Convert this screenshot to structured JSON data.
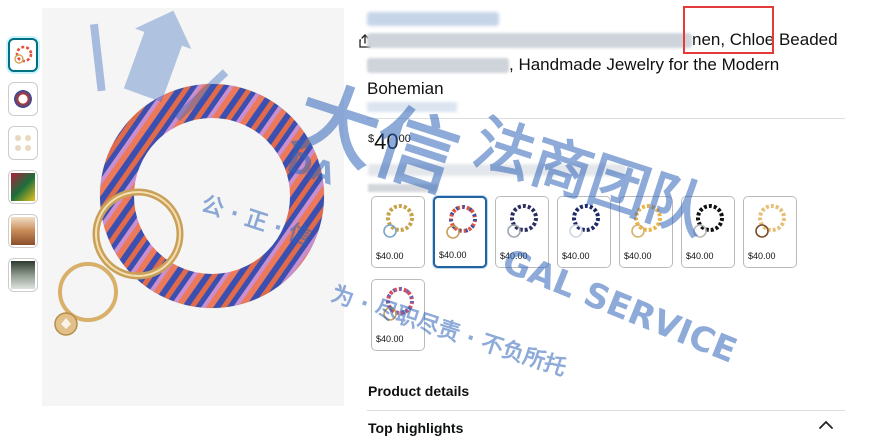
{
  "product": {
    "title_line1_visible": "nen, Chloe Beaded",
    "title_line2_visible": ", Handmade Jewelry for the Modern",
    "title_line3": "Bohemian",
    "price": {
      "symbol": "$",
      "whole": "40",
      "fraction": "00"
    }
  },
  "swatches": [
    {
      "price": "$40.00",
      "selected": false,
      "colors": [
        "#c7a24a",
        "#7aa6c9"
      ]
    },
    {
      "price": "$40.00",
      "selected": true,
      "colors": [
        "#e0563f",
        "#3c4fa8"
      ]
    },
    {
      "price": "$40.00",
      "selected": false,
      "colors": [
        "#2b2f5e",
        "#9fa7b4"
      ]
    },
    {
      "price": "$40.00",
      "selected": false,
      "colors": [
        "#1e2a66",
        "#cfd6e6"
      ]
    },
    {
      "price": "$40.00",
      "selected": false,
      "colors": [
        "#e8b44b",
        "#f1e6c6"
      ]
    },
    {
      "price": "$40.00",
      "selected": false,
      "colors": [
        "#111111",
        "#d9d9d9"
      ]
    },
    {
      "price": "$40.00",
      "selected": false,
      "colors": [
        "#e6c07a",
        "#7a4d2a"
      ]
    },
    {
      "price": "$40.00",
      "selected": false,
      "colors": [
        "#d74d5a",
        "#6e64b5"
      ]
    }
  ],
  "sections": {
    "product_details": "Product details",
    "top_highlights": "Top highlights"
  },
  "watermark": {
    "cjk_main": "大信",
    "cjk_side": "法商团队",
    "latin_1": "DA",
    "latin_2": "GAL SERVICE",
    "motto": "公 · 正 · 信",
    "motto2": "为 · 尽职尽责 · 不负所托"
  },
  "colors": {
    "selected_border": "#2162a1",
    "highlight_red": "#e53a3a",
    "watermark_blue": "#2f64b8"
  }
}
